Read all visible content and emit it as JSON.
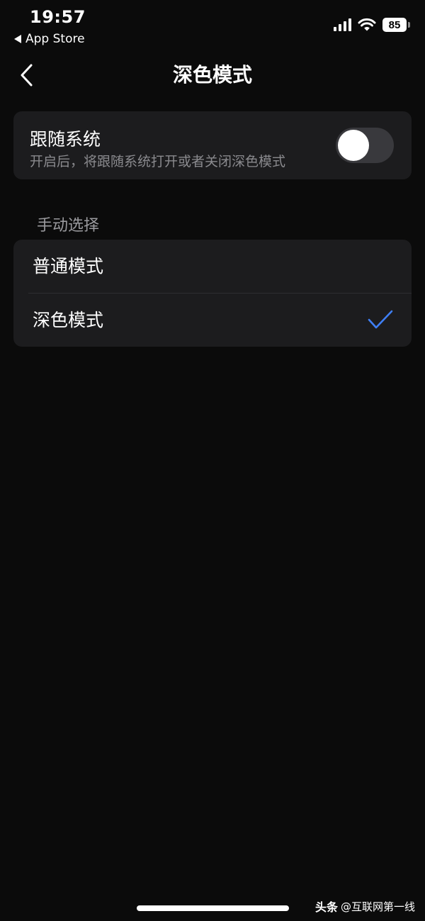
{
  "status_bar": {
    "time": "19:57",
    "back_app": "App Store",
    "battery": "85"
  },
  "nav": {
    "title": "深色模式"
  },
  "follow_system": {
    "title": "跟随系统",
    "description": "开启后，将跟随系统打开或者关闭深色模式",
    "enabled": false
  },
  "manual": {
    "section_label": "手动选择",
    "options": [
      {
        "label": "普通模式",
        "selected": false
      },
      {
        "label": "深色模式",
        "selected": true
      }
    ]
  },
  "watermark": {
    "brand": "头条",
    "account": "@互联网第一线"
  },
  "colors": {
    "background": "#0b0b0b",
    "card": "#1c1c1e",
    "accent_check": "#3f7ff5",
    "secondary_text": "#8a8a8e"
  }
}
